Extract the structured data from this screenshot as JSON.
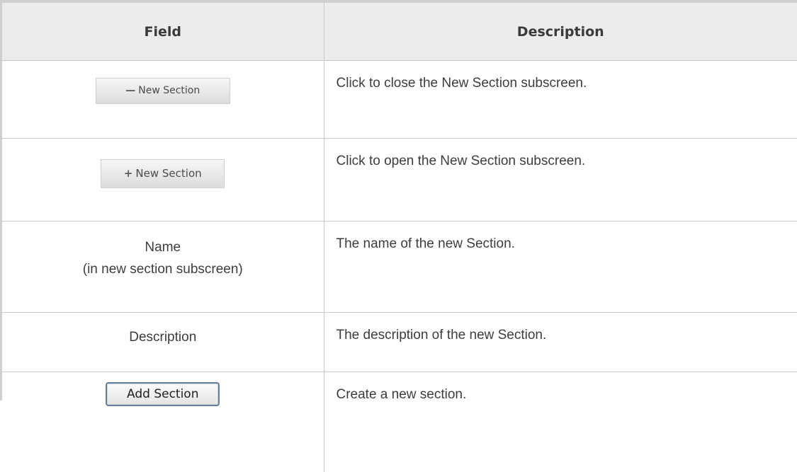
{
  "table": {
    "headers": {
      "field": "Field",
      "description": "Description"
    },
    "rows": [
      {
        "field_button": {
          "icon": "minus-icon",
          "label": "New Section"
        },
        "description": "Click to close the New Section subscreen."
      },
      {
        "field_button": {
          "icon": "plus-icon",
          "label": "New Section"
        },
        "description": "Click to open the New Section subscreen."
      },
      {
        "field_line1": "Name",
        "field_line2": "(in new section subscreen)",
        "description": "The name of the new Section."
      },
      {
        "field": "Description",
        "description": "The description of the new Section."
      },
      {
        "field_button": {
          "label": "Add Section"
        },
        "description": "Create a new section."
      }
    ]
  },
  "colors": {
    "header_background": "#ececec",
    "border": "#c9c9c9",
    "text": "#3d3d3d"
  }
}
